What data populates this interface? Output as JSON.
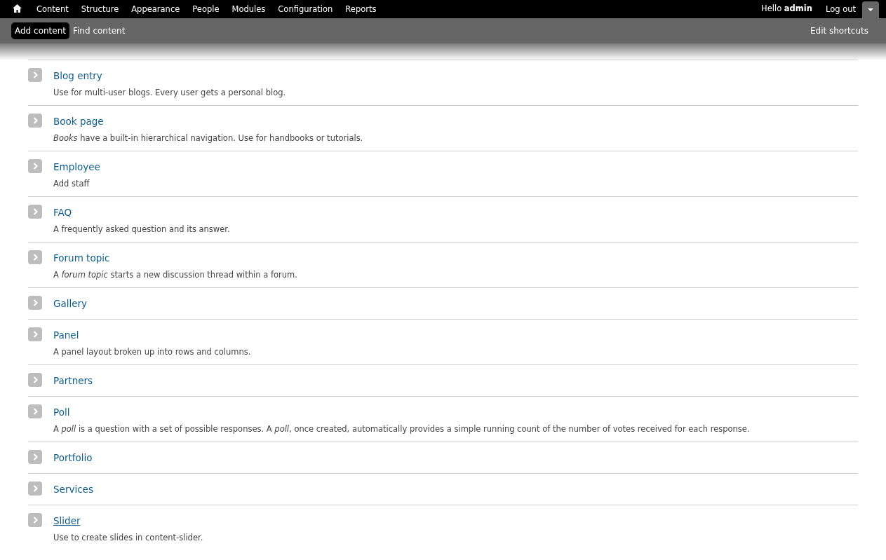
{
  "toolbar": {
    "menu": [
      {
        "label": "Content"
      },
      {
        "label": "Structure"
      },
      {
        "label": "Appearance"
      },
      {
        "label": "People"
      },
      {
        "label": "Modules"
      },
      {
        "label": "Configuration"
      },
      {
        "label": "Reports"
      }
    ],
    "greeting": "Hello **admin**",
    "logout": "Log out"
  },
  "shortcuts": {
    "items": [
      {
        "label": "Add content",
        "selected": true
      },
      {
        "label": "Find content",
        "selected": false
      }
    ],
    "edit": "Edit shortcuts"
  },
  "content_types": [
    {
      "title": "Blog entry",
      "description": "Use for multi-user blogs. Every user gets a personal blog.",
      "hovered": false
    },
    {
      "title": "Book page",
      "description": "*Books* have a built-in hierarchical navigation. Use for handbooks or tutorials.",
      "hovered": false
    },
    {
      "title": "Employee",
      "description": "Add staff",
      "hovered": false
    },
    {
      "title": "FAQ",
      "description": "A frequently asked question and its answer.",
      "hovered": false
    },
    {
      "title": "Forum topic",
      "description": "A *forum topic* starts a new discussion thread within a forum.",
      "hovered": false
    },
    {
      "title": "Gallery",
      "hovered": false
    },
    {
      "title": "Panel",
      "description": "A panel layout broken up into rows and columns.",
      "hovered": false
    },
    {
      "title": "Partners",
      "hovered": false
    },
    {
      "title": "Poll",
      "description": "A *poll* is a question with a set of possible responses. A *poll*, once created, automatically provides a simple running count of the number of votes received for each response.",
      "hovered": false
    },
    {
      "title": "Portfolio",
      "hovered": false
    },
    {
      "title": "Services",
      "hovered": false
    },
    {
      "title": "Slider",
      "description": "Use to create slides in content-slider.",
      "hovered": true
    }
  ]
}
